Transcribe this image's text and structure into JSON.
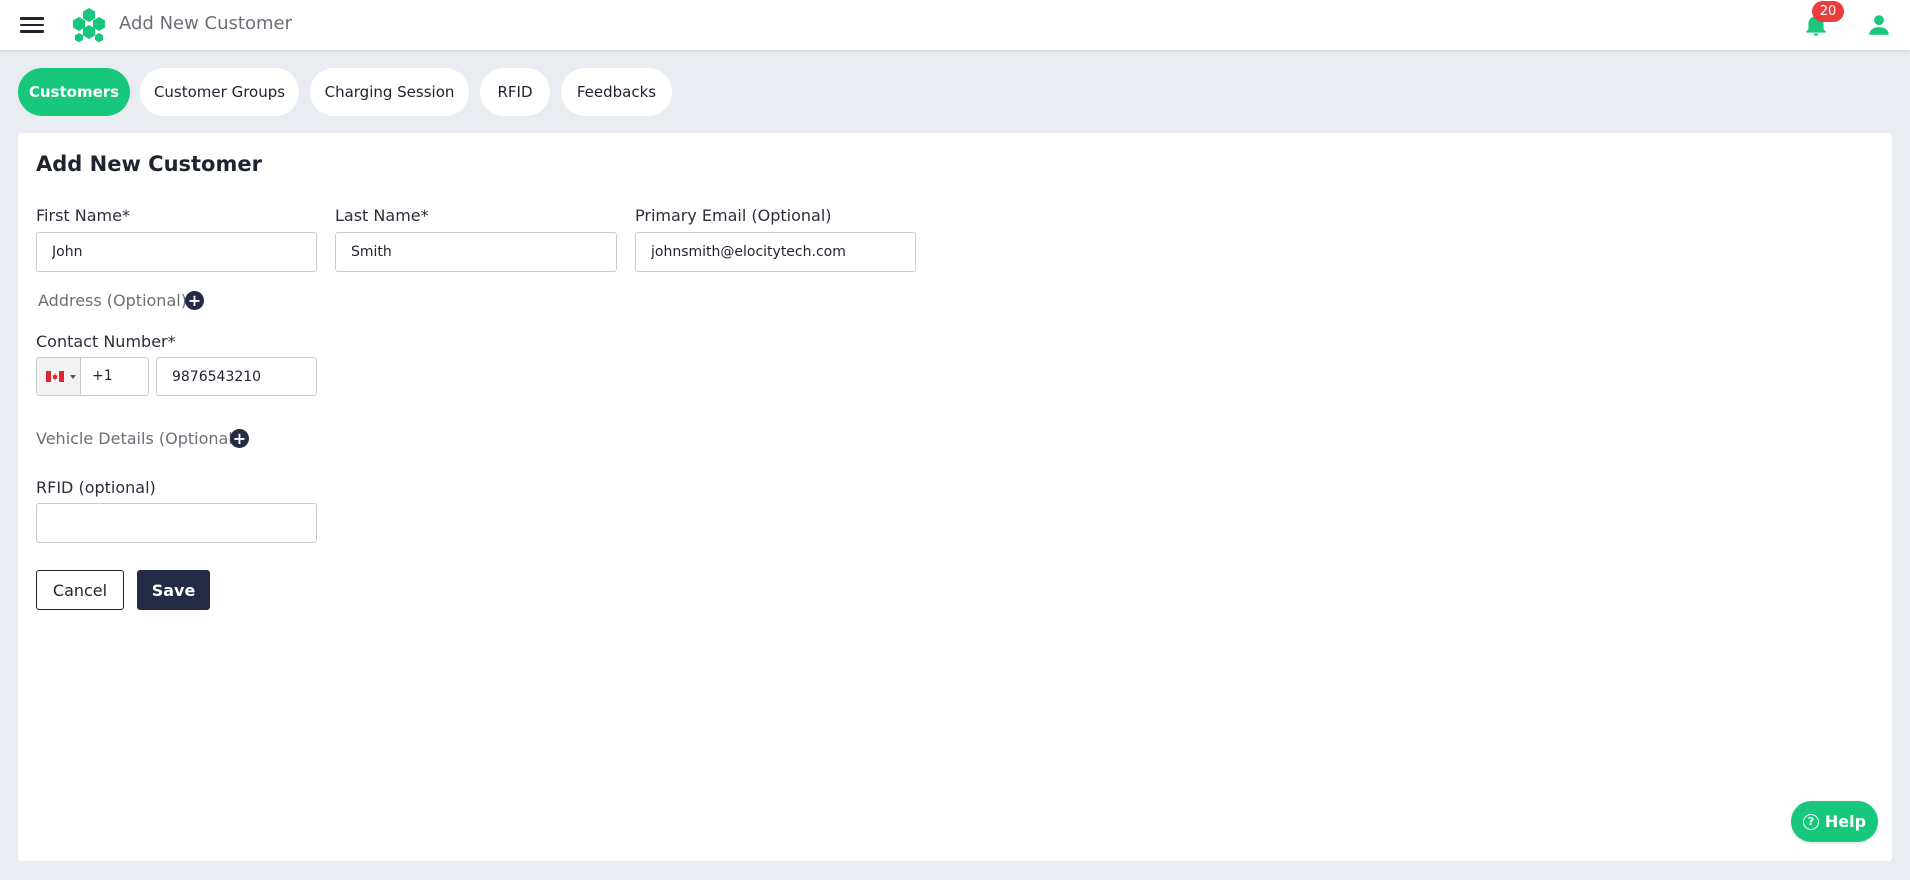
{
  "header": {
    "title": "Add New Customer",
    "notification_count": "20",
    "icons": {
      "menu": "hamburger-menu-icon",
      "logo": "hexagon-cluster-logo",
      "bell": "bell-icon",
      "user": "user-icon"
    }
  },
  "tabs": [
    {
      "label": "Customers",
      "active": true
    },
    {
      "label": "Customer Groups",
      "active": false
    },
    {
      "label": "Charging Session",
      "active": false
    },
    {
      "label": "RFID",
      "active": false
    },
    {
      "label": "Feedbacks",
      "active": false
    }
  ],
  "form": {
    "title": "Add New Customer",
    "first_name": {
      "label": "First Name*",
      "value": "John"
    },
    "last_name": {
      "label": "Last Name*",
      "value": "Smith"
    },
    "email": {
      "label": "Primary Email (Optional)",
      "value": "johnsmith@elocitytech.com"
    },
    "address": {
      "label": "Address (Optional)"
    },
    "contact": {
      "label": "Contact Number*",
      "country_flag": "canada-flag",
      "dial_code": "+1",
      "value": "9876543210"
    },
    "vehicle": {
      "label": "Vehicle Details (Optional)"
    },
    "rfid": {
      "label": "RFID (optional)",
      "value": ""
    },
    "cancel_label": "Cancel",
    "save_label": "Save"
  },
  "help": {
    "label": "Help"
  },
  "colors": {
    "accent": "#17c77c",
    "dark": "#232a44",
    "badge": "#ea3e3e",
    "background": "#e9edf2"
  }
}
